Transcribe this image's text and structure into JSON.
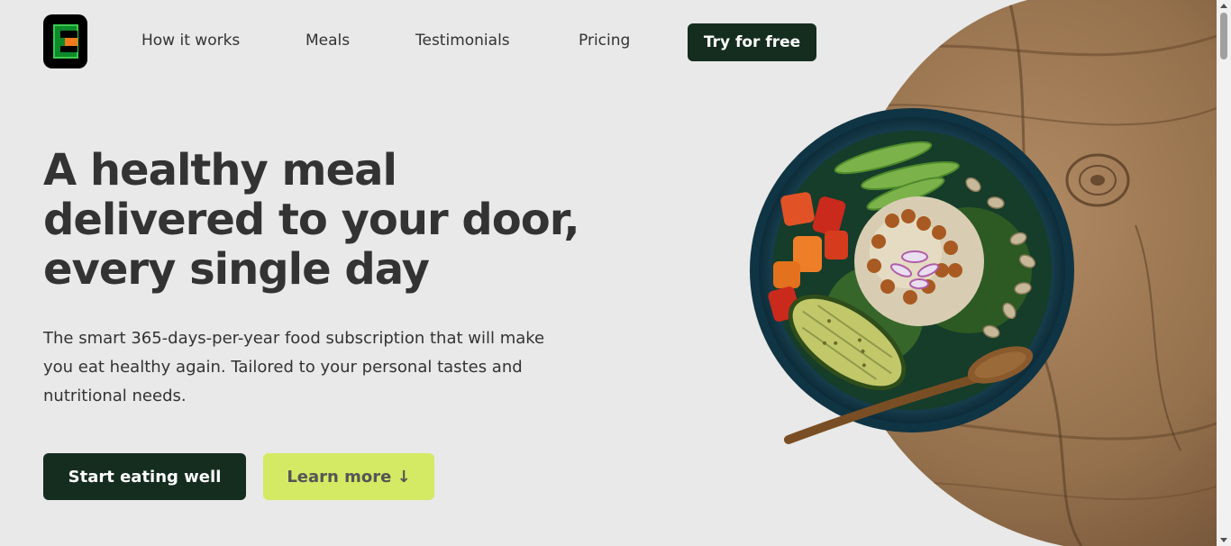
{
  "nav": {
    "logo": "logo-icon",
    "links": [
      "How it works",
      "Meals",
      "Testimonials",
      "Pricing"
    ],
    "cta": "Try for free"
  },
  "hero": {
    "title": "A healthy meal delivered to your door, every single day",
    "description": "The smart 365-days-per-year food subscription that will make you eat healthy again. Tailored to your personal tastes and nutritional needs.",
    "primary_button": "Start eating well",
    "secondary_button": "Learn more ↓",
    "image": "food-bowl-image"
  },
  "colors": {
    "background": "#e8e9e8",
    "primary": "#142d1f",
    "accent": "#d4ea64",
    "text": "#333333"
  }
}
